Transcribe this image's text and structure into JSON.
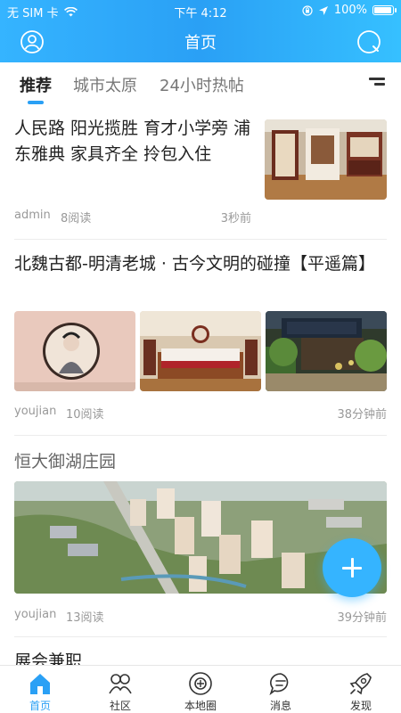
{
  "status_bar": {
    "carrier": "无 SIM 卡",
    "time": "下午 4:12",
    "battery": "100%",
    "battery_level": 1.0
  },
  "nav": {
    "title": "首页",
    "avatar_icon": "user-icon",
    "search_icon": "search-icon"
  },
  "tabs": [
    {
      "label": "推荐",
      "active": true
    },
    {
      "label": "城市太原",
      "active": false
    },
    {
      "label": "24小时热帖",
      "active": false
    }
  ],
  "feed": [
    {
      "title": "人民路 阳光揽胜 育才小学旁 浦东雅典 家具齐全 拎包入住",
      "author": "admin",
      "reads": "8阅读",
      "time": "3秒前",
      "images": [
        "apartment-room-photo"
      ]
    },
    {
      "title": "北魏古都-明清老城 · 古今文明的碰撞【平遥篇】",
      "author": "youjian",
      "reads": "10阅读",
      "time": "38分钟前",
      "images": [
        "wall-painting-photo",
        "hotel-bedroom-photo",
        "old-street-photo"
      ]
    },
    {
      "title": "恒大御湖庄园",
      "author": "youjian",
      "reads": "13阅读",
      "time": "39分钟前",
      "images": [
        "aerial-residential-photo"
      ]
    },
    {
      "title": "展会兼职"
    }
  ],
  "bottom_nav": [
    {
      "label": "首页",
      "icon": "home-icon",
      "active": true
    },
    {
      "label": "社区",
      "icon": "community-icon",
      "active": false
    },
    {
      "label": "本地圈",
      "icon": "local-circle-icon",
      "active": false
    },
    {
      "label": "消息",
      "icon": "message-icon",
      "active": false
    },
    {
      "label": "发现",
      "icon": "rocket-icon",
      "active": false
    }
  ],
  "colors": {
    "accent": "#2aa0f5",
    "header_gradient_start": "#35b4ff",
    "header_gradient_end": "#36c0ff",
    "fab": "#35b4ff"
  }
}
